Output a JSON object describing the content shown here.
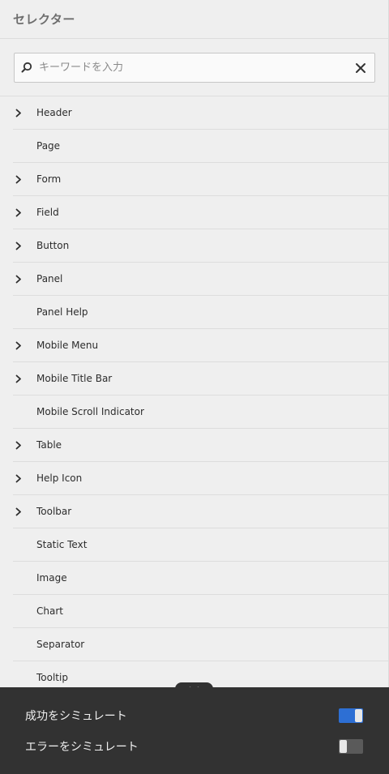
{
  "header": {
    "title": "セレクター"
  },
  "search": {
    "placeholder": "キーワードを入力",
    "value": ""
  },
  "tree": {
    "items": [
      {
        "label": "Header",
        "expandable": true
      },
      {
        "label": "Page",
        "expandable": false
      },
      {
        "label": "Form",
        "expandable": true
      },
      {
        "label": "Field",
        "expandable": true
      },
      {
        "label": "Button",
        "expandable": true
      },
      {
        "label": "Panel",
        "expandable": true
      },
      {
        "label": "Panel Help",
        "expandable": false
      },
      {
        "label": "Mobile Menu",
        "expandable": true
      },
      {
        "label": "Mobile Title Bar",
        "expandable": true
      },
      {
        "label": "Mobile Scroll Indicator",
        "expandable": false
      },
      {
        "label": "Table",
        "expandable": true
      },
      {
        "label": "Help Icon",
        "expandable": true
      },
      {
        "label": "Toolbar",
        "expandable": true
      },
      {
        "label": "Static Text",
        "expandable": false
      },
      {
        "label": "Image",
        "expandable": false
      },
      {
        "label": "Chart",
        "expandable": false
      },
      {
        "label": "Separator",
        "expandable": false
      },
      {
        "label": "Tooltip",
        "expandable": false
      }
    ]
  },
  "footer": {
    "simulate_success": {
      "label": "成功をシミュレート",
      "enabled": true
    },
    "simulate_error": {
      "label": "エラーをシミュレート",
      "enabled": false
    }
  },
  "colors": {
    "accent": "#2d6fd4",
    "footer_bg": "#323232",
    "panel_bg": "#efefef"
  }
}
